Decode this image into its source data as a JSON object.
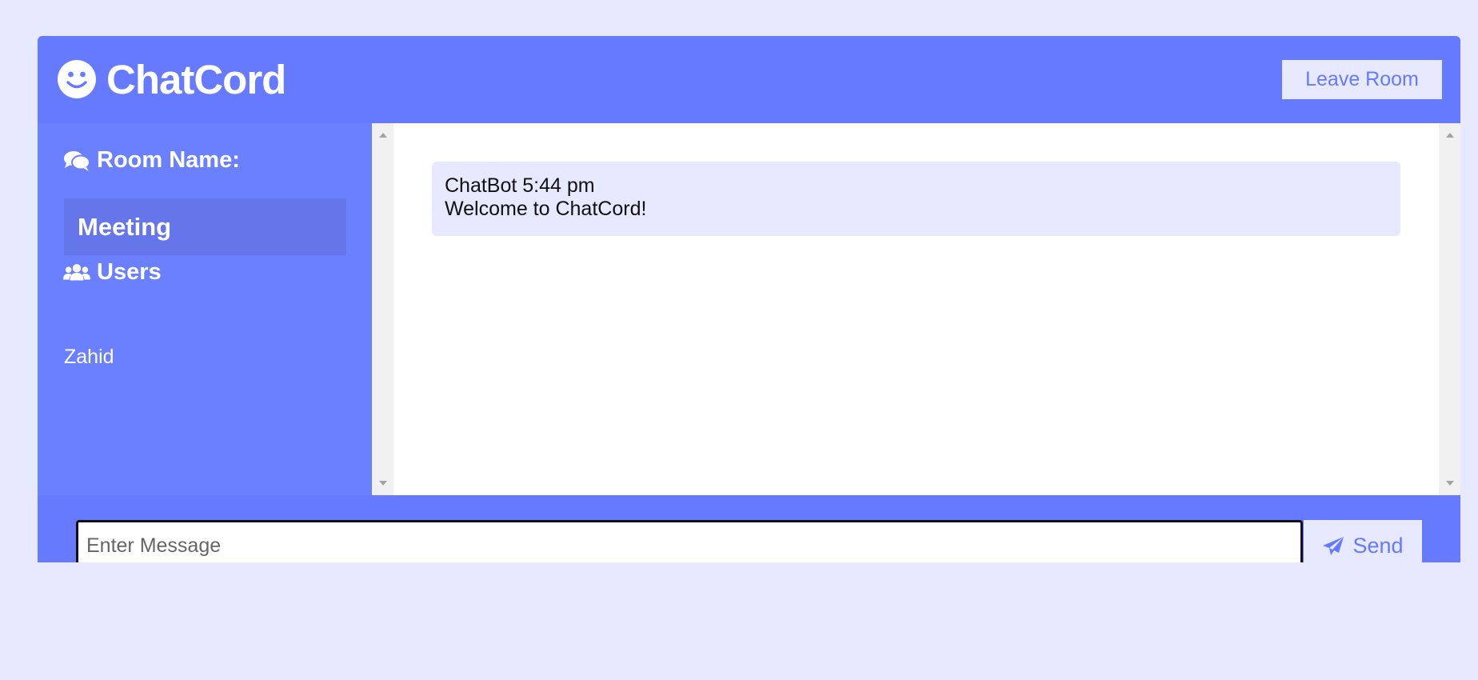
{
  "header": {
    "logo_icon": "smile-icon",
    "title": "ChatCord",
    "leave_label": "Leave Room"
  },
  "sidebar": {
    "room_heading": "Room Name:",
    "room_icon": "comments-icon",
    "room_name": "Meeting",
    "users_heading": "Users",
    "users_icon": "users-icon",
    "users": [
      "Zahid"
    ]
  },
  "messages": [
    {
      "meta": "ChatBot 5:44 pm",
      "text": "Welcome to ChatCord!"
    }
  ],
  "form": {
    "placeholder": "Enter Message",
    "value": "",
    "send_label": "Send",
    "send_icon": "paper-plane-icon"
  },
  "colors": {
    "primary": "#667aff",
    "sidebar": "#6b80ff",
    "light": "#e6e9ff",
    "room_box": "#6576ea"
  }
}
